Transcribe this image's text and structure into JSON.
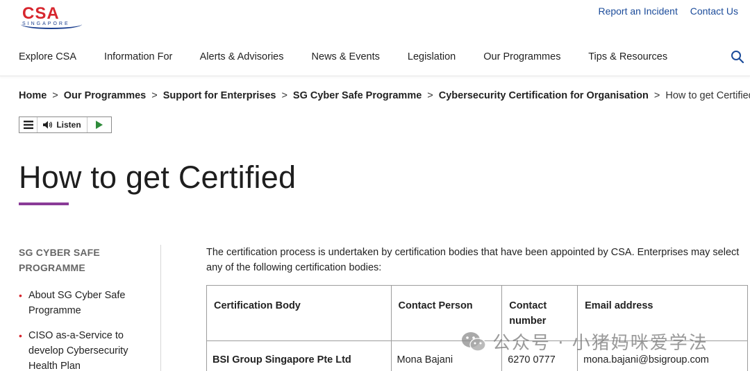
{
  "header": {
    "logo_text_primary": "CSA",
    "logo_text_secondary": "SINGAPORE",
    "utility_links": [
      "Report an Incident",
      "Contact Us"
    ],
    "nav_items": [
      "Explore CSA",
      "Information For",
      "Alerts & Advisories",
      "News & Events",
      "Legislation",
      "Our Programmes",
      "Tips & Resources"
    ],
    "search_icon": "search-icon"
  },
  "breadcrumb": {
    "items": [
      "Home",
      "Our Programmes",
      "Support for Enterprises",
      "SG Cyber Safe Programme",
      "Cybersecurity Certification for Organisation"
    ],
    "separator": ">",
    "current": "How to get Certified"
  },
  "listen_widget": {
    "label": "Listen",
    "icons": [
      "menu-icon",
      "speaker-icon",
      "play-icon"
    ]
  },
  "page": {
    "title": "How to get Certified",
    "accent_color": "#8a3b97"
  },
  "sidebar": {
    "heading": "SG CYBER SAFE PROGRAMME",
    "items": [
      "About SG Cyber Safe Programme",
      "CISO as-a-Service to develop Cybersecurity Health Plan"
    ]
  },
  "main": {
    "intro": "The certification process is undertaken by certification bodies that have been appointed by CSA. Enterprises may select any of the following certification bodies:",
    "table": {
      "headers": [
        "Certification Body",
        "Contact Person",
        "Contact number",
        "Email address"
      ],
      "rows": [
        [
          "BSI Group Singapore Pte Ltd",
          "Mona Bajani",
          "6270 0777",
          "mona.bajani@bsigroup.com"
        ]
      ]
    }
  },
  "watermark": {
    "text": "公众号 · 小猪妈咪爱学法",
    "icon": "wechat-icon"
  },
  "colors": {
    "brand_red": "#d7262e",
    "brand_blue": "#1b3f8f",
    "link_blue": "#1b4b9a",
    "accent_purple": "#8a3b97"
  }
}
